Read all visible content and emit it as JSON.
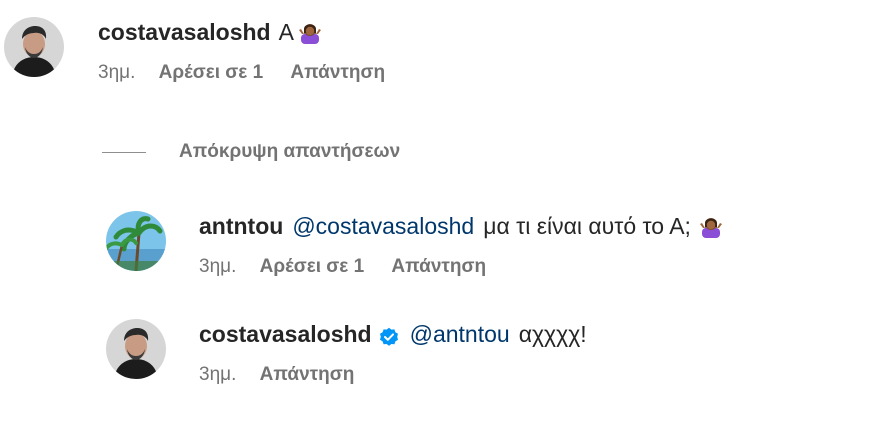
{
  "comments": [
    {
      "username": "costavasaloshd",
      "text": "Α",
      "emoji": "woman-shrugging-emoji",
      "time": "3ημ.",
      "likes": "Αρέσει σε 1",
      "reply": "Απάντηση"
    }
  ],
  "hide_replies": {
    "label": "Απόκρυψη απαντήσεων"
  },
  "replies": [
    {
      "username": "antntou",
      "mention": "@costavasaloshd",
      "text": "μα τι είναι αυτό το Α;",
      "emoji": "woman-shrugging-emoji",
      "time": "3ημ.",
      "likes": "Αρέσει σε 1",
      "reply": "Απάντηση"
    },
    {
      "username": "costavasaloshd",
      "verified": true,
      "mention": "@antntou",
      "text": "αχχχχ!",
      "time": "3ημ.",
      "reply": "Απάντηση"
    }
  ],
  "colors": {
    "text": "#262626",
    "secondary": "#737373",
    "mention": "#00376b",
    "verified": "#0095f6"
  }
}
